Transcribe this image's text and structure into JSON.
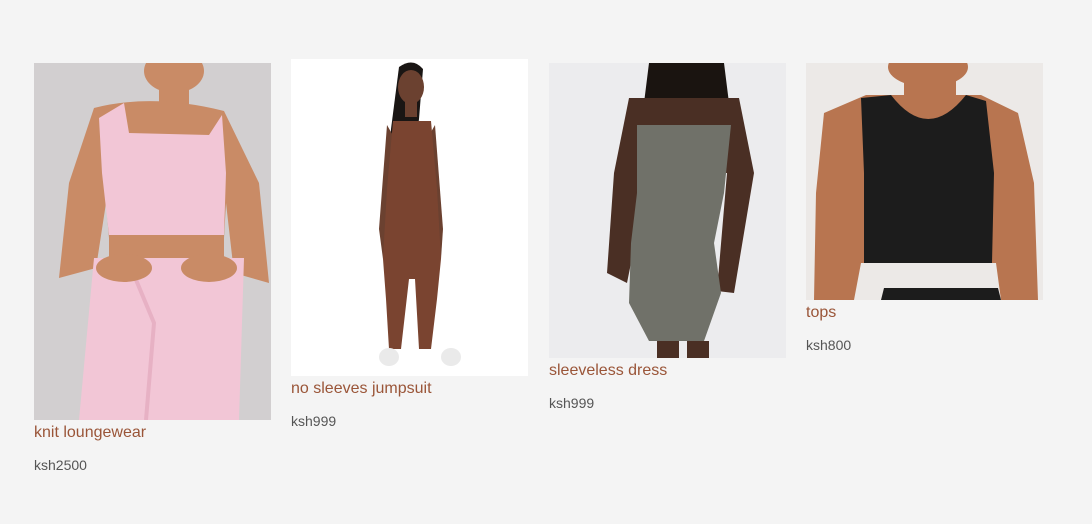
{
  "products": [
    {
      "title": "knit loungewear",
      "price": "ksh2500",
      "colors": {
        "bg": "#d2cfd0",
        "item": "#f2c6d6",
        "skin": "#c98b66"
      }
    },
    {
      "title": "no sleeves jumpsuit",
      "price": "ksh999",
      "colors": {
        "bg": "#ffffff",
        "item": "#7a4430",
        "skin": "#6b4130"
      }
    },
    {
      "title": "sleeveless dress",
      "price": "ksh999",
      "colors": {
        "bg": "#ececee",
        "item": "#707169",
        "skin": "#4a2f24"
      }
    },
    {
      "title": "tops",
      "price": "ksh800",
      "colors": {
        "bg": "#ece9e7",
        "item": "#1c1c1c",
        "skin": "#b87550"
      }
    }
  ]
}
